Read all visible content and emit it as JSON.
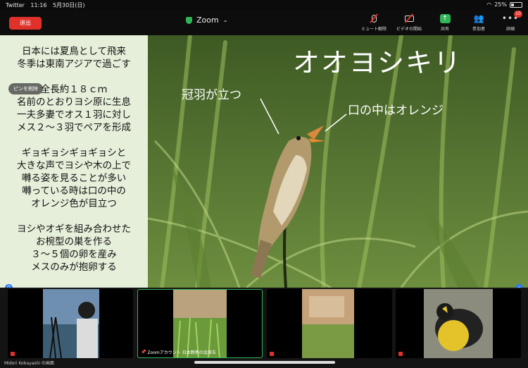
{
  "status_bar": {
    "carrier": "Twitter",
    "time": "11:16",
    "date": "5月30日(日)",
    "battery": "25%"
  },
  "toolbar": {
    "leave_label": "退出",
    "title": "Zoom",
    "items": [
      {
        "label": "ミュート解除",
        "icon": "mic-muted-icon"
      },
      {
        "label": "ビデオの開始",
        "icon": "video-off-icon"
      },
      {
        "label": "共有",
        "icon": "share-icon"
      },
      {
        "label": "参加者",
        "icon": "participants-icon"
      },
      {
        "label": "詳細",
        "icon": "more-icon",
        "badge": "10"
      }
    ]
  },
  "share": {
    "stop_label": "ピンを削除",
    "lines": [
      "日本には夏鳥として飛来",
      "冬季は東南アジアで過ごす",
      "",
      "全長約１８ｃｍ",
      "名前のとおりヨシ原に生息",
      "一夫多妻でオス１羽に対し",
      "メス２〜３羽でペアを形成",
      "",
      "ギョギョシギョギョシと",
      "大きな声でヨシや木の上で",
      "囀る姿を見ることが多い",
      "囀っている時は口の中の",
      "オレンジ色が目立つ",
      "",
      "ヨシやオギを組み合わせた",
      "お椀型の巣を作る",
      "３〜５個の卵を産み",
      "メスのみが抱卵する"
    ],
    "bird_name": "オオヨシキリ",
    "annotation_crest": "冠羽が立つ",
    "annotation_mouth": "口の中はオレンジ"
  },
  "gallery": {
    "tiles": [
      {
        "name": "",
        "active": false
      },
      {
        "name": "Zoomアカウント 日本野鳥の会埼玉",
        "active": true
      },
      {
        "name": "",
        "active": false
      },
      {
        "name": "",
        "active": false
      }
    ],
    "footer_name": "Midori Kobayashi の画面"
  },
  "colors": {
    "leave": "#e0322a",
    "share": "#2fb558",
    "active_border": "#35b35a",
    "panel_bg": "#e6efda"
  }
}
